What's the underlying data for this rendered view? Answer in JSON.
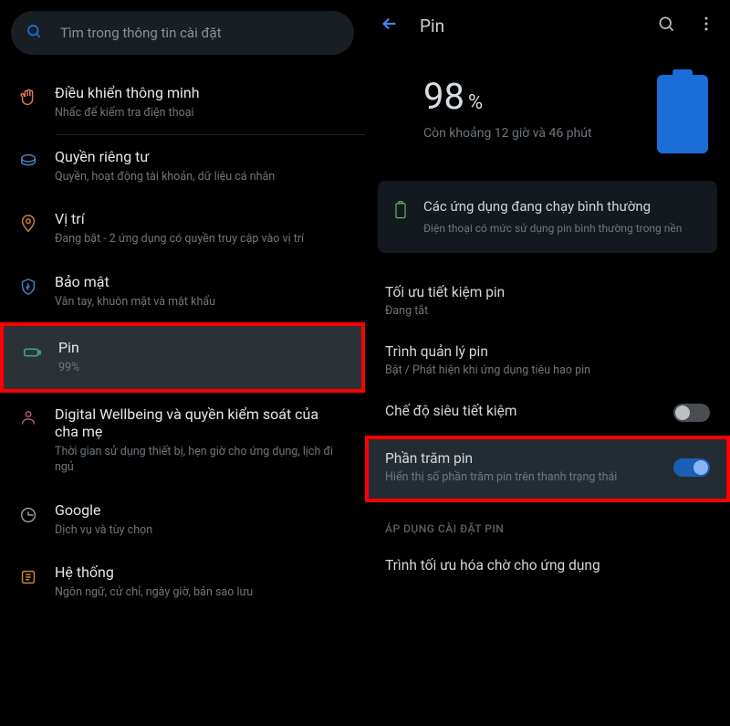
{
  "left": {
    "search_placeholder": "Tìm trong thông tin cài đặt",
    "items": [
      {
        "title": "Điều khiển thông minh",
        "sub": "Nhấc để kiểm tra điện thoại"
      },
      {
        "title": "Quyền riêng tư",
        "sub": "Quyền, hoạt động tài khoản, dữ liệu cá nhân"
      },
      {
        "title": "Vị trí",
        "sub": "Đang bật - 2 ứng dụng có quyền truy cập vào vị trí"
      },
      {
        "title": "Bảo mật",
        "sub": "Vân tay, khuôn mặt và mật khẩu"
      },
      {
        "title": "Pin",
        "sub": "99%"
      },
      {
        "title": "Digital Wellbeing và quyền kiểm soát của cha mẹ",
        "sub": "Thời gian sử dụng thiết bị, hẹn giờ cho ứng dụng, lịch đi ngủ"
      },
      {
        "title": "Google",
        "sub": "Dịch vụ và tùy chọn"
      },
      {
        "title": "Hệ thống",
        "sub": "Ngôn ngữ, cử chỉ, ngày giờ, bản sao lưu"
      }
    ]
  },
  "right": {
    "header_title": "Pin",
    "battery_value": "98",
    "battery_unit": "%",
    "battery_remain": "Còn khoảng 12 giờ và 46 phút",
    "card_title": "Các ứng dụng đang chạy bình thường",
    "card_sub": "Điện thoại có mức sử dụng pin bình thường trong nền",
    "items": [
      {
        "title": "Tối ưu tiết kiệm pin",
        "sub": "Đang tắt"
      },
      {
        "title": "Trình quản lý pin",
        "sub": "Bật / Phát hiện khi ứng dụng tiêu hao pin"
      },
      {
        "title": "Chế độ siêu tiết kiệm",
        "sub": ""
      },
      {
        "title": "Phần trăm pin",
        "sub": "Hiển thị số phần trăm pin trên thanh trạng thái"
      }
    ],
    "section_label": "ÁP DỤNG CÀI ĐẶT PIN",
    "last_item": "Trình tối ưu hóa chờ cho ứng dụng"
  }
}
